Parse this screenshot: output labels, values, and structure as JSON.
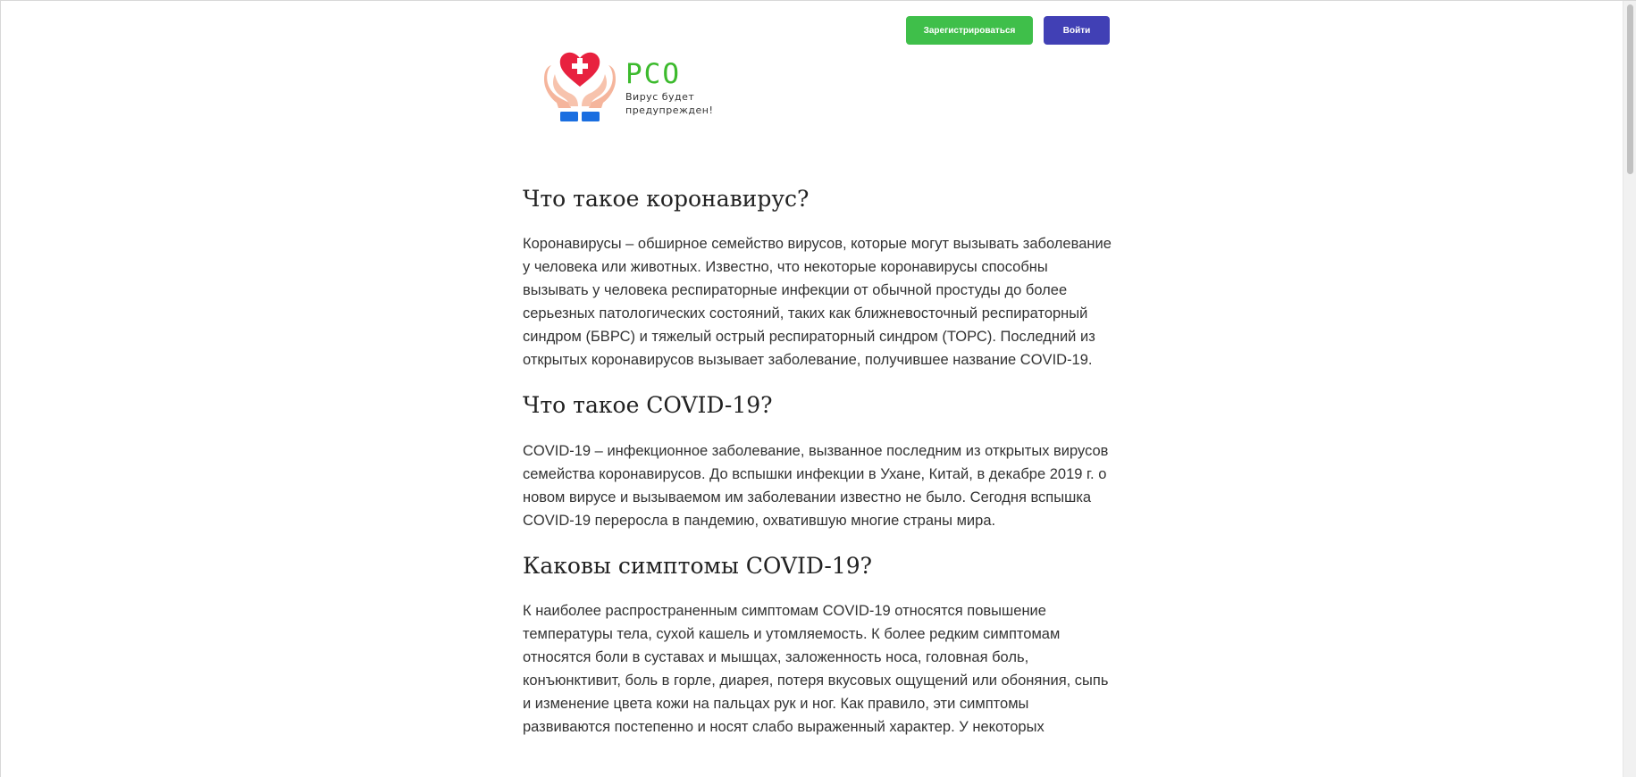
{
  "header": {
    "register_label": "Зарегистрироваться",
    "login_label": "Войти"
  },
  "logo": {
    "name": "РСО",
    "tagline": "Вирус будет предупрежден!"
  },
  "sections": [
    {
      "title": "Что такое коронавирус?",
      "text": "Коронавирусы – обширное семейство вирусов, которые могут вызывать заболевание у человека или животных. Известно, что некоторые коронавирусы способны вызывать у человека респираторные инфекции от обычной простуды до более серьезных патологических состояний, таких как ближневосточный респираторный синдром (БВРС) и тяжелый острый респираторный синдром (ТОРС). Последний из открытых коронавирусов вызывает заболевание, получившее название COVID-19."
    },
    {
      "title": "Что такое COVID-19?",
      "text": "COVID-19 – инфекционное заболевание, вызванное последним из открытых вирусов семейства коронавирусов. До вспышки инфекции в Ухане, Китай, в декабре 2019 г. о новом вирусе и вызываемом им заболевании известно не было. Сегодня вспышка COVID-19 переросла в пандемию, охватившую многие страны мира."
    },
    {
      "title": "Каковы симптомы COVID-19?",
      "text": "К наиболее распространенным симптомам COVID-19 относятся повышение температуры тела, сухой кашель и утомляемость. К более редким симптомам относятся боли в суставах и мышцах, заложенность носа, головная боль, конъюнктивит, боль в горле, диарея, потеря вкусовых ощущений или обоняния, сыпь и изменение цвета кожи на пальцах рук и ног. Как правило, эти симптомы развиваются постепенно и носят слабо выраженный характер. У некоторых"
    }
  ],
  "colors": {
    "register": "#3fbf4a",
    "login": "#4140b5",
    "brand": "#3cba2d",
    "heart": "#e8213f"
  }
}
